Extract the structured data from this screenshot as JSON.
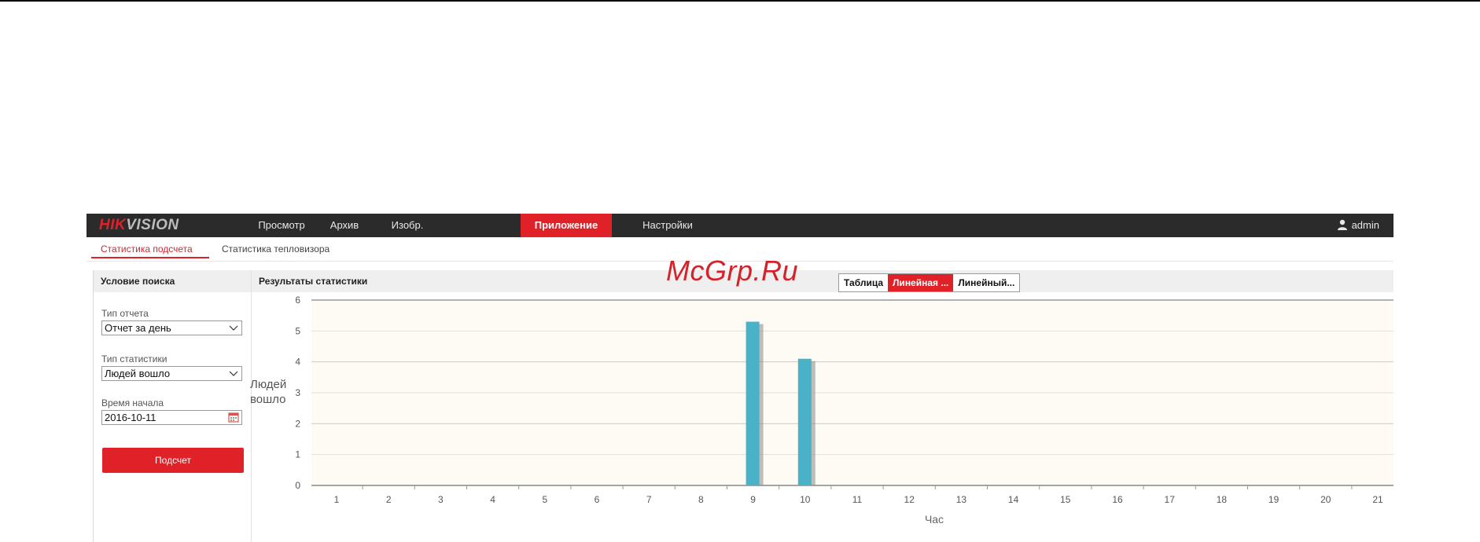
{
  "app": {
    "logo_part1": "HIK",
    "logo_part2": "VISION",
    "user": "admin"
  },
  "nav": [
    {
      "label": "Просмотр",
      "active": false
    },
    {
      "label": "Архив",
      "active": false
    },
    {
      "label": "Изобр.",
      "active": false
    },
    {
      "label": "Приложение",
      "active": true
    },
    {
      "label": "Настройки",
      "active": false
    }
  ],
  "subtabs": [
    {
      "label": "Статистика подсчета",
      "active": true
    },
    {
      "label": "Статистика тепловизора",
      "active": false
    }
  ],
  "search": {
    "title": "Условие поиска",
    "report_type_label": "Тип отчета",
    "report_type_value": "Отчет за день",
    "stat_type_label": "Тип статистики",
    "stat_type_value": "Людей вошло",
    "start_time_label": "Время начала",
    "start_time_value": "2016-10-11",
    "count_button": "Подсчет"
  },
  "results": {
    "title": "Результаты статистики",
    "view_tabs": [
      {
        "label": "Таблица",
        "active": false
      },
      {
        "label": "Линейная ...",
        "active": true
      },
      {
        "label": "Линейный...",
        "active": false
      }
    ]
  },
  "watermark": "McGrp.Ru",
  "colors": {
    "accent": "#e02128",
    "navbar": "#2b2b2b",
    "bar": "#4ab2c8",
    "plot_bg": "#fdfbf3"
  },
  "chart_data": {
    "type": "bar",
    "xlabel": "Час",
    "ylabel_line1": "Людей",
    "ylabel_line2": "вошло",
    "ylim": [
      0,
      6
    ],
    "yticks": [
      0,
      1,
      2,
      3,
      4,
      5,
      6
    ],
    "categories": [
      "1",
      "2",
      "3",
      "4",
      "5",
      "6",
      "7",
      "8",
      "9",
      "10",
      "11",
      "12",
      "13",
      "14",
      "15",
      "16",
      "17",
      "18",
      "19",
      "20",
      "21"
    ],
    "values": [
      0,
      0,
      0,
      0,
      0,
      0,
      0,
      0,
      5.3,
      4.1,
      0,
      0,
      0,
      0,
      0,
      0,
      0,
      0,
      0,
      0,
      0
    ],
    "grid": true
  }
}
